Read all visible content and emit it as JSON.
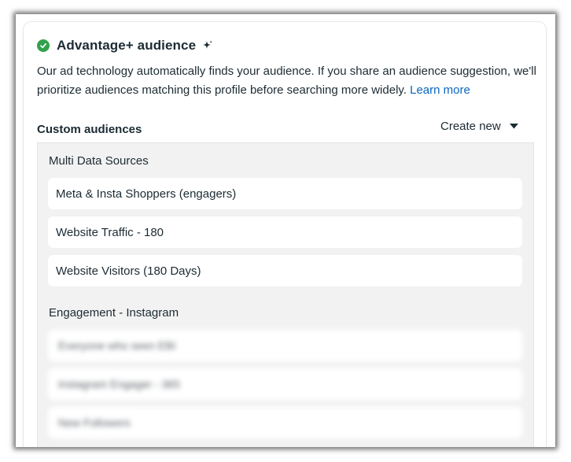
{
  "card": {
    "title": "Advantage+ audience",
    "description": "Our ad technology automatically finds your audience. If you share an audience suggestion, we'll prioritize audiences matching this profile before searching more widely.",
    "learn_more": "Learn more"
  },
  "custom_audiences": {
    "label": "Custom audiences",
    "create_new": "Create new",
    "groups": [
      {
        "label": "Multi Data Sources",
        "items": [
          "Meta & Insta Shoppers (engagers)",
          "Website Traffic - 180",
          "Website Visitors (180 Days)"
        ]
      },
      {
        "label": "Engagement - Instagram",
        "items": [
          "Everyone who seen EBI",
          "Instagram Engager - 365",
          "New Followers"
        ]
      }
    ]
  },
  "colors": {
    "accent": "#31a24c",
    "link": "#0a66c2",
    "panel": "#f2f2f2"
  },
  "icons": {
    "status": "check-circle-icon",
    "sparkle": "sparkle-icon",
    "dropdown": "caret-down-icon"
  }
}
